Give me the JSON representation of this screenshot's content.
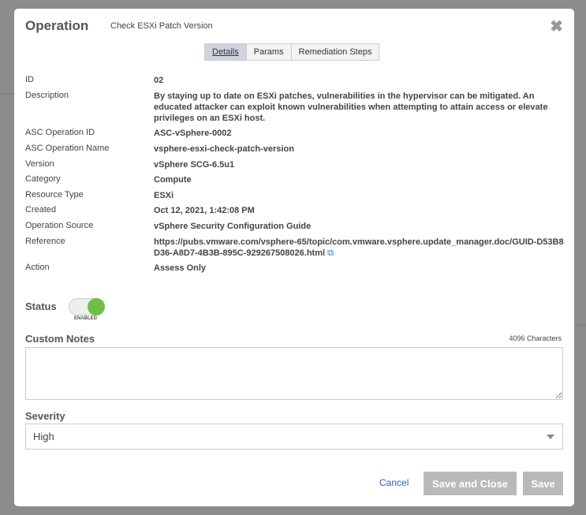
{
  "header": {
    "title": "Operation",
    "subtitle": "Check ESXi Patch Version",
    "close": "✖"
  },
  "tabs": [
    {
      "label": "Details",
      "active": true
    },
    {
      "label": "Params"
    },
    {
      "label": "Remediation Steps"
    }
  ],
  "details": [
    {
      "label": "ID",
      "value": "02"
    },
    {
      "label": "Description",
      "value": "By staying up to date on ESXi patches, vulnerabilities in the hypervisor can be mitigated. An educated attacker can exploit known vulnerabilities when attempting to attain access or elevate privileges on an ESXi host."
    },
    {
      "label": "ASC Operation ID",
      "value": "ASC-vSphere-0002"
    },
    {
      "label": "ASC Operation Name",
      "value": "vsphere-esxi-check-patch-version"
    },
    {
      "label": "Version",
      "value": "vSphere SCG-6.5u1"
    },
    {
      "label": "Category",
      "value": "Compute"
    },
    {
      "label": "Resource Type",
      "value": "ESXi"
    },
    {
      "label": "Created",
      "value": "Oct 12, 2021, 1:42:08 PM"
    },
    {
      "label": "Operation Source",
      "value": "vSphere Security Configuration Guide"
    },
    {
      "label": "Reference",
      "value": "https://pubs.vmware.com/vsphere-65/topic/com.vmware.vsphere.update_manager.doc/GUID-D53B8D36-A8D7-4B3B-895C-929267508026.html",
      "icon": "external-link-icon"
    },
    {
      "label": "Action",
      "value": "Assess Only"
    }
  ],
  "status": {
    "label": "Status",
    "state": "ENABLED",
    "on": true,
    "color": "#6dbf45"
  },
  "notes": {
    "label": "Custom Notes",
    "limit": "4096 Characters",
    "value": ""
  },
  "severity": {
    "label": "Severity",
    "value": "High"
  },
  "footer": {
    "cancel": "Cancel",
    "save_close": "Save and Close",
    "save": "Save"
  }
}
